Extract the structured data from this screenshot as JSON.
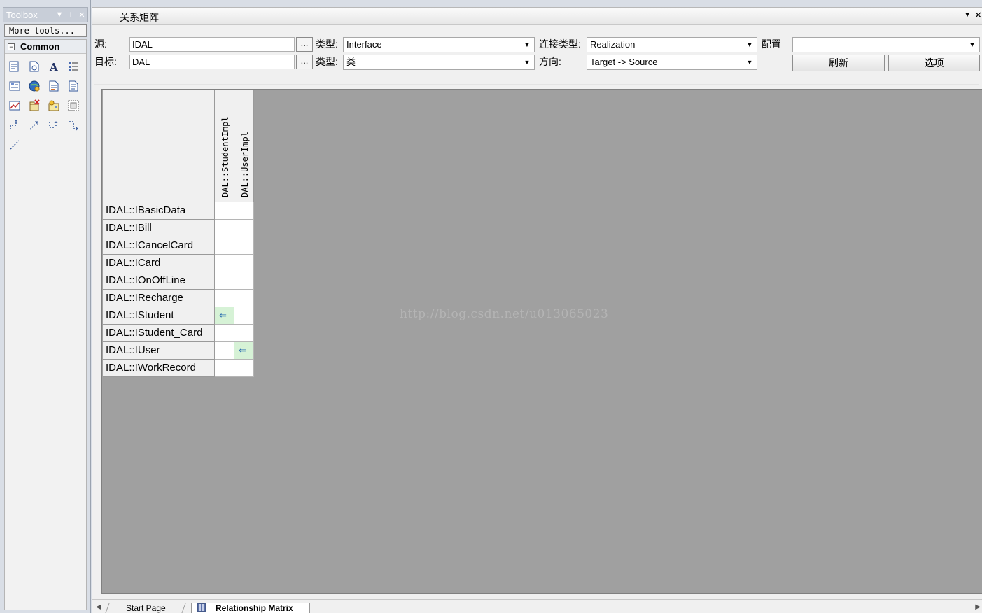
{
  "toolbox": {
    "title": "Toolbox",
    "more_tools": "More tools...",
    "section": "Common",
    "tools": [
      {
        "name": "note-icon"
      },
      {
        "name": "document-icon"
      },
      {
        "name": "text-icon"
      },
      {
        "name": "list-icon"
      },
      {
        "name": "hyperlink-icon"
      },
      {
        "name": "globe-icon"
      },
      {
        "name": "artifact-icon"
      },
      {
        "name": "report-icon"
      },
      {
        "name": "diagram-icon"
      },
      {
        "name": "package-delete-icon"
      },
      {
        "name": "legend-icon"
      },
      {
        "name": "boundary-icon"
      },
      {
        "name": "dependency-icon"
      },
      {
        "name": "trace-icon"
      },
      {
        "name": "note-link-icon"
      },
      {
        "name": "constraint-icon"
      },
      {
        "name": "dashed-line-icon"
      }
    ]
  },
  "document": {
    "title": "关系矩阵"
  },
  "filters": {
    "source_label": "源:",
    "source_value": "IDAL",
    "target_label": "目标:",
    "target_value": "DAL",
    "dots": "...",
    "type_label": "类型:",
    "source_type": "Interface",
    "target_type": "类",
    "link_type_label": "连接类型:",
    "link_type": "Realization",
    "direction_label": "方向:",
    "direction": "Target -> Source",
    "config_label": "配置",
    "config_value": "",
    "refresh": "刷新",
    "options": "选项"
  },
  "matrix": {
    "columns": [
      "DAL::StudentImpl",
      "DAL::UserImpl"
    ],
    "rows": [
      {
        "label": "IDAL::IBasicData",
        "cells": [
          "",
          ""
        ]
      },
      {
        "label": "IDAL::IBill",
        "cells": [
          "",
          ""
        ]
      },
      {
        "label": "IDAL::ICancelCard",
        "cells": [
          "",
          ""
        ]
      },
      {
        "label": "IDAL::ICard",
        "cells": [
          "",
          ""
        ]
      },
      {
        "label": "IDAL::IOnOffLine",
        "cells": [
          "",
          ""
        ]
      },
      {
        "label": "IDAL::IRecharge",
        "cells": [
          "",
          ""
        ]
      },
      {
        "label": "IDAL::IStudent",
        "cells": [
          "⇐",
          ""
        ]
      },
      {
        "label": "IDAL::IStudent_Card",
        "cells": [
          "",
          ""
        ]
      },
      {
        "label": "IDAL::IUser",
        "cells": [
          "",
          "⇐"
        ]
      },
      {
        "label": "IDAL::IWorkRecord",
        "cells": [
          "",
          ""
        ]
      }
    ],
    "marked_color": "#d6f2d6"
  },
  "watermark": "http://blog.csdn.net/u013065023",
  "tabs": {
    "start_page": "Start Page",
    "relationship_matrix": "Relationship Matrix"
  }
}
